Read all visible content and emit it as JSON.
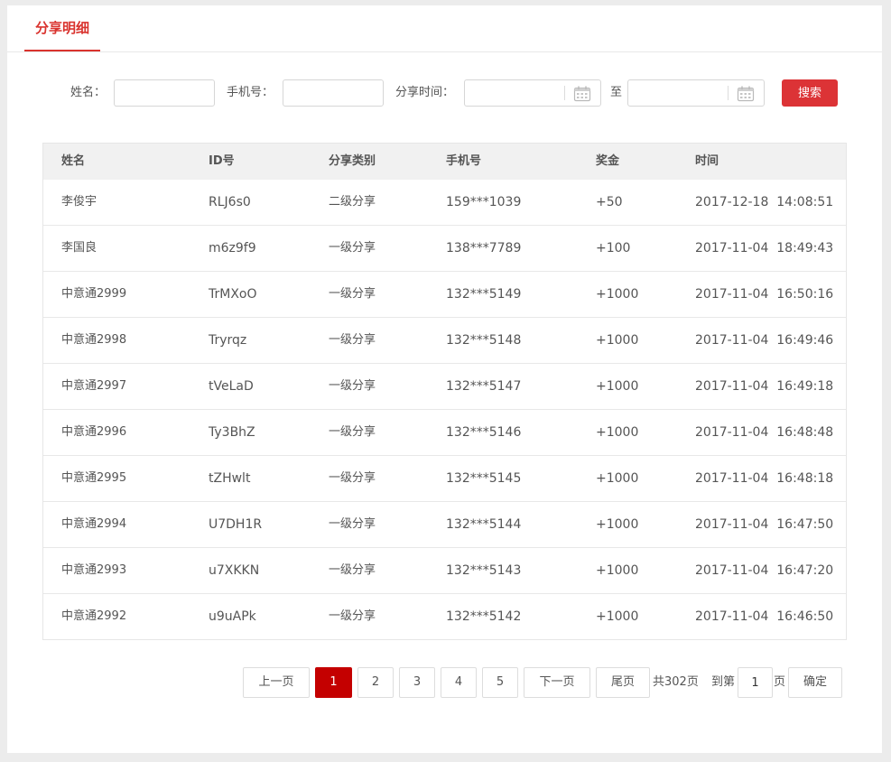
{
  "tab": {
    "label": "分享明细"
  },
  "filters": {
    "name_label": "姓名：",
    "phone_label": "手机号：",
    "time_label": "分享时间：",
    "to_label": "至",
    "name_value": "",
    "phone_value": "",
    "start_value": "",
    "end_value": "",
    "search_label": "搜索"
  },
  "table": {
    "headers": [
      "姓名",
      "ID号",
      "分享类别",
      "手机号",
      "奖金",
      "时间"
    ],
    "rows": [
      [
        "李俊宇",
        "RLJ6s0",
        "二级分享",
        "159***1039",
        "+50",
        "2017-12-18  14:08:51"
      ],
      [
        "李国良",
        "m6z9f9",
        "一级分享",
        "138***7789",
        "+100",
        "2017-11-04  18:49:43"
      ],
      [
        "中意通2999",
        "TrMXoO",
        "一级分享",
        "132***5149",
        "+1000",
        "2017-11-04  16:50:16"
      ],
      [
        "中意通2998",
        "Tryrqz",
        "一级分享",
        "132***5148",
        "+1000",
        "2017-11-04  16:49:46"
      ],
      [
        "中意通2997",
        "tVeLaD",
        "一级分享",
        "132***5147",
        "+1000",
        "2017-11-04  16:49:18"
      ],
      [
        "中意通2996",
        "Ty3BhZ",
        "一级分享",
        "132***5146",
        "+1000",
        "2017-11-04  16:48:48"
      ],
      [
        "中意通2995",
        "tZHwlt",
        "一级分享",
        "132***5145",
        "+1000",
        "2017-11-04  16:48:18"
      ],
      [
        "中意通2994",
        "U7DH1R",
        "一级分享",
        "132***5144",
        "+1000",
        "2017-11-04  16:47:50"
      ],
      [
        "中意通2993",
        "u7XKKN",
        "一级分享",
        "132***5143",
        "+1000",
        "2017-11-04  16:47:20"
      ],
      [
        "中意通2992",
        "u9uAPk",
        "一级分享",
        "132***5142",
        "+1000",
        "2017-11-04  16:46:50"
      ]
    ]
  },
  "pagination": {
    "prev_label": "上一页",
    "pages": [
      "1",
      "2",
      "3",
      "4",
      "5"
    ],
    "current_page": "1",
    "next_label": "下一页",
    "last_label": "尾页",
    "total_label": "共302页",
    "goto_label": "到第",
    "goto_value": "1",
    "page_suffix": "页",
    "confirm_label": "确定"
  },
  "colors": {
    "accent": "#dc3336",
    "active_page": "#c40000"
  },
  "icons": {
    "date_picker": "calendar-icon"
  }
}
